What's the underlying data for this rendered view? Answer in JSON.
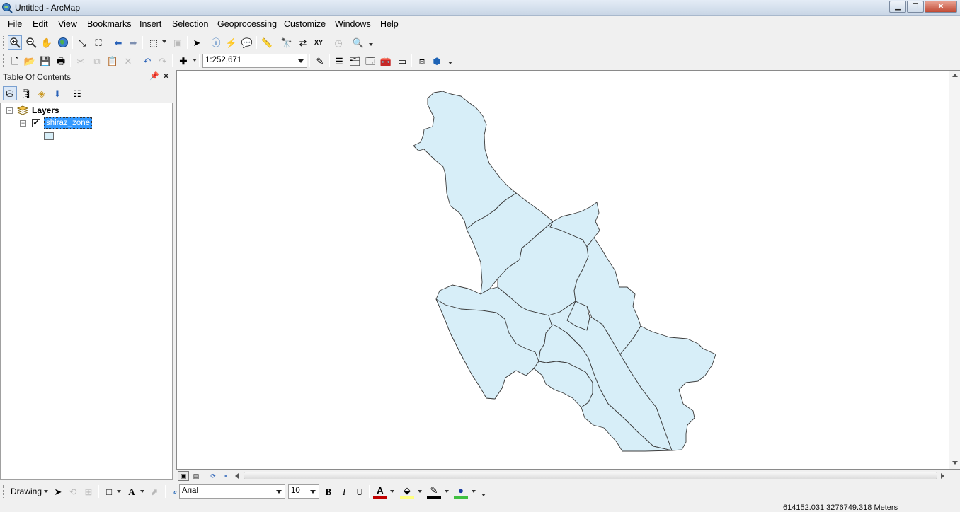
{
  "window": {
    "title": "Untitled - ArcMap",
    "controls": [
      "minimize",
      "restore",
      "close"
    ]
  },
  "menubar": {
    "items": [
      "File",
      "Edit",
      "View",
      "Bookmarks",
      "Insert",
      "Selection",
      "Geoprocessing",
      "Customize",
      "Windows",
      "Help"
    ]
  },
  "standard_toolbar": {
    "scale": "1:252,671"
  },
  "toc": {
    "title": "Table Of Contents",
    "root_label": "Layers",
    "layer": {
      "name": "shiraz_zone",
      "visible": true,
      "selected": true,
      "fill_color": "#d7eef8",
      "outline_color": "#3c3c3c"
    }
  },
  "drawing_toolbar": {
    "drawing_label": "Drawing",
    "font_name": "Arial",
    "font_size": "10",
    "bold_label": "B",
    "italic_label": "I",
    "underline_label": "U",
    "font_color": "#c00000",
    "fill_color": "#ffff80",
    "line_color": "#000000",
    "marker_color": "#40c040"
  },
  "status": {
    "coordinates": "614152.031  3276749.318 Meters"
  },
  "colors": {
    "selection": "#3399ff",
    "polygon_fill": "#d7eef8",
    "polygon_outline": "#3c3c3c"
  }
}
